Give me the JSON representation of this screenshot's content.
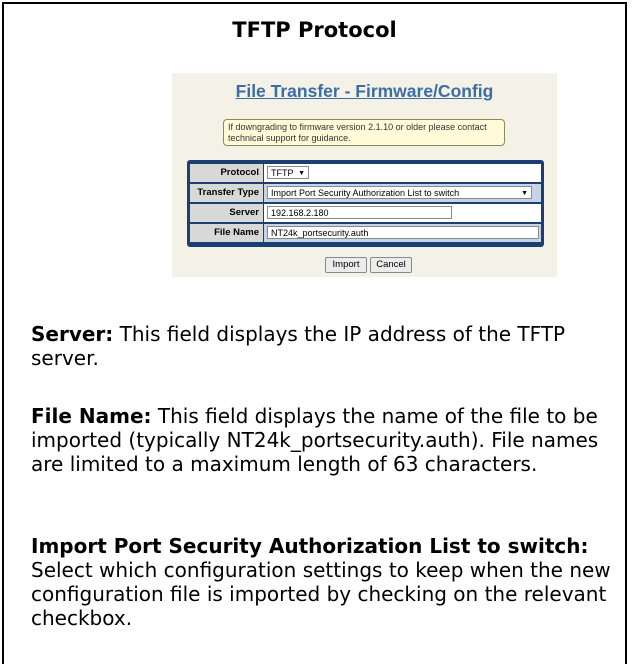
{
  "doc": {
    "title": "TFTP Protocol"
  },
  "screenshot": {
    "title": "File Transfer - Firmware/Config",
    "notice": "If downgrading to firmware version 2.1.10 or older please contact technical support for guidance.",
    "fields": {
      "protocol_label": "Protocol",
      "protocol_value": "TFTP",
      "transfer_type_label": "Transfer Type",
      "transfer_type_value": "Import Port Security Authorization List to switch",
      "server_label": "Server",
      "server_value": "192.168.2.180",
      "file_name_label": "File Name",
      "file_name_value": "NT24k_portsecurity.auth"
    },
    "buttons": {
      "import": "Import",
      "cancel": "Cancel"
    },
    "colors": {
      "title": "#3a6ea5",
      "form_border": "#1c3f72",
      "notice_bg": "#fffbd9"
    }
  },
  "paragraphs": {
    "server_term": "Server:",
    "server_text": " This field displays the IP address of the TFTP server.",
    "file_name_term": "File Name:",
    "file_name_text": " This field displays the name of the file to be imported (typically NT24k_portsecurity.auth). File names are limited to a maximum length of 63 characters.",
    "import_term": "Import Port Security Authorization List to switch:",
    "import_text": " Select which configuration settings to keep when the new configuration file is imported by checking on the relevant checkbox."
  }
}
